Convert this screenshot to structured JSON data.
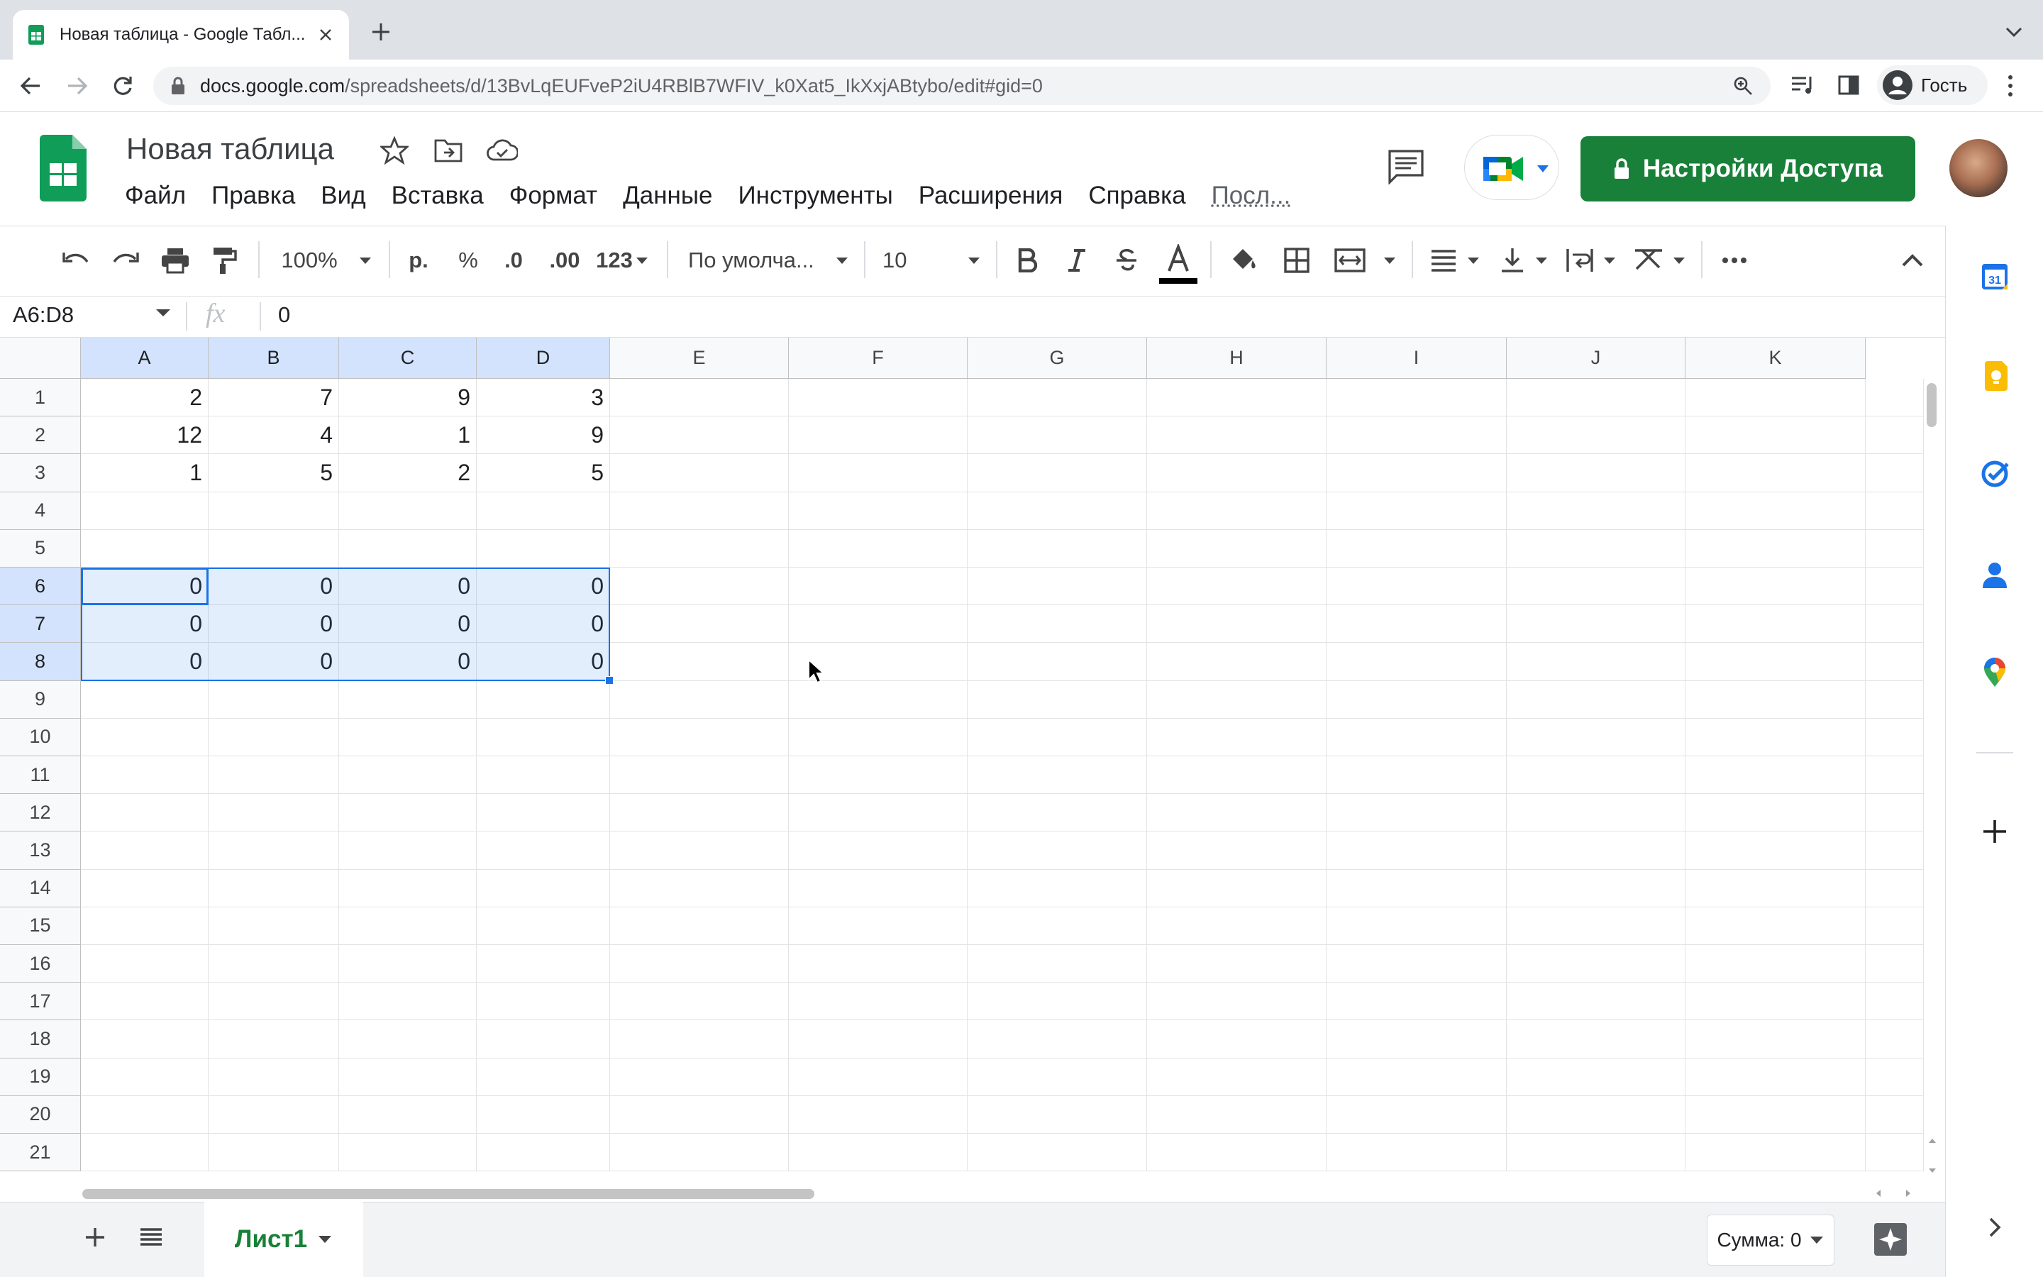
{
  "browser": {
    "tab_title": "Новая таблица - Google Табл...",
    "url_host": "docs.google.com",
    "url_path": "/spreadsheets/d/13BvLqEUFveP2iU4RBlB7WFIV_k0Xat5_IkXxjABtybo/edit#gid=0",
    "profile_label": "Гость"
  },
  "doc": {
    "title": "Новая таблица",
    "share_label": "Настройки Доступа"
  },
  "menu": [
    "Файл",
    "Правка",
    "Вид",
    "Вставка",
    "Формат",
    "Данные",
    "Инструменты",
    "Расширения",
    "Справка",
    "Посл..."
  ],
  "toolbar": {
    "zoom": "100%",
    "currency": "р.",
    "percent": "%",
    "dec_decrease": ".0",
    "dec_increase": ".00",
    "number_format": "123",
    "font": "По умолча...",
    "font_size": "10"
  },
  "formula_bar": {
    "name_box": "A6:D8",
    "fx": "fx",
    "value": "0"
  },
  "grid": {
    "columns": [
      "A",
      "B",
      "C",
      "D",
      "E",
      "F",
      "G",
      "H",
      "I",
      "J",
      "K"
    ],
    "rows": [
      "1",
      "2",
      "3",
      "4",
      "5",
      "6",
      "7",
      "8",
      "9",
      "10",
      "11",
      "12",
      "13",
      "14",
      "15",
      "16",
      "17",
      "18",
      "19",
      "20",
      "21"
    ],
    "cells": [
      [
        "2",
        "7",
        "9",
        "3"
      ],
      [
        "12",
        "4",
        "1",
        "9"
      ],
      [
        "1",
        "5",
        "2",
        "5"
      ],
      [
        "",
        "",
        "",
        ""
      ],
      [
        "",
        "",
        "",
        ""
      ],
      [
        "0",
        "0",
        "0",
        "0"
      ],
      [
        "0",
        "0",
        "0",
        "0"
      ],
      [
        "0",
        "0",
        "0",
        "0"
      ]
    ],
    "selection": "A6:D8"
  },
  "bottom": {
    "sheet_name": "Лист1",
    "sum_label": "Сумма: 0"
  },
  "colors": {
    "share_green": "#188038",
    "selection_blue": "#1a73e8",
    "tab_strip": "#dee1e6"
  }
}
